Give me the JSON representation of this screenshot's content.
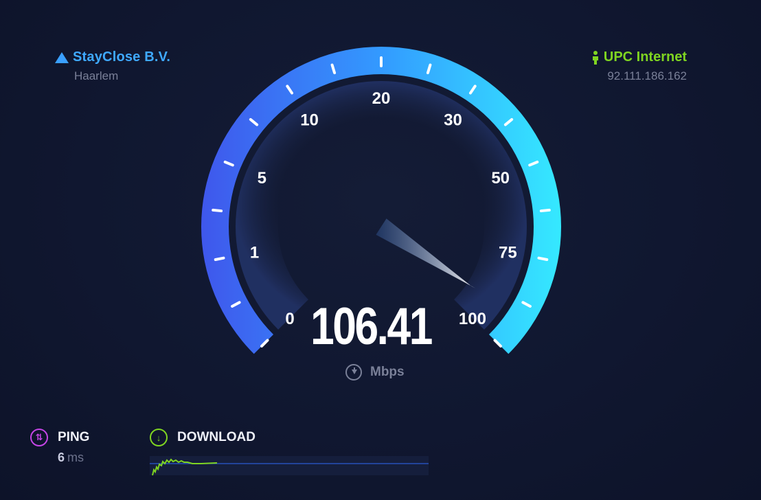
{
  "server": {
    "name": "StayClose B.V.",
    "location": "Haarlem",
    "icon": "server-triangle-icon"
  },
  "isp": {
    "name": "UPC Internet",
    "ip": "92.111.186.162",
    "icon": "person-icon"
  },
  "gauge": {
    "scale_labels": [
      "0",
      "1",
      "5",
      "10",
      "20",
      "30",
      "50",
      "75",
      "100"
    ],
    "current_speed": "106.41",
    "unit": "Mbps",
    "needle_value_mbps": 106.41,
    "colors": {
      "start": "#3f57ec",
      "mid": "#33a1ff",
      "end": "#35e6ff"
    }
  },
  "ping": {
    "label": "PING",
    "value": "6",
    "unit": "ms",
    "color": "#c545e6"
  },
  "download": {
    "label": "DOWNLOAD",
    "color": "#7fd521"
  }
}
